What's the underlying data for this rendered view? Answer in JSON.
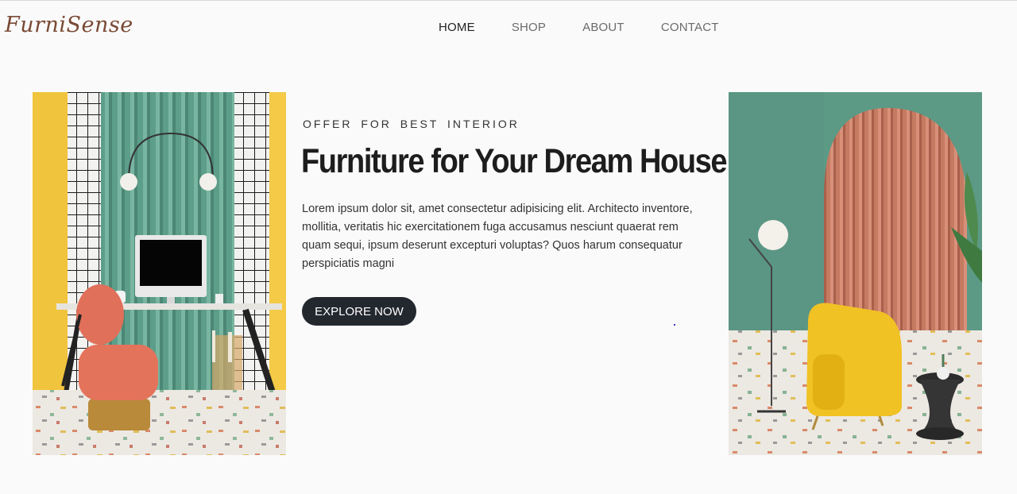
{
  "header": {
    "logo": "FurniSense",
    "nav": [
      {
        "label": "HOME",
        "active": true
      },
      {
        "label": "SHOP",
        "active": false
      },
      {
        "label": "ABOUT",
        "active": false
      },
      {
        "label": "CONTACT",
        "active": false
      }
    ]
  },
  "hero": {
    "kicker": "OFFER FOR BEST INTERIOR",
    "headline": "Furniture for Your Dream House",
    "body": "Lorem ipsum dolor sit, amet consectetur adipisicing elit. Architecto inventore, mollitia, veritatis hic exercitationem fuga accusamus nesciunt quaerat rem quam sequi, ipsum deserunt excepturi voluptas? Quos harum consequatur perspiciatis magni",
    "cta_label": "EXPLORE NOW"
  },
  "colors": {
    "brand": "#7a4a35",
    "button": "#23272e",
    "background": "#fafafa"
  }
}
